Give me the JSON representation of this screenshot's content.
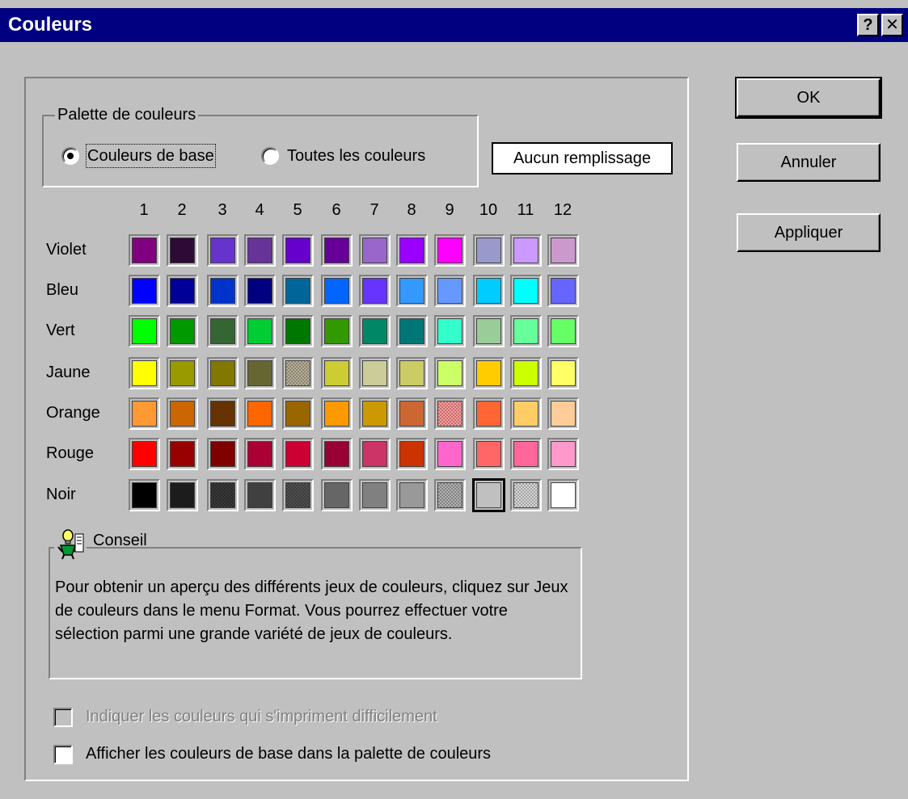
{
  "window": {
    "title": "Couleurs",
    "help_glyph": "?",
    "close_glyph": "✕"
  },
  "palette_group": {
    "legend": "Palette de couleurs",
    "options": [
      {
        "label": "Couleurs de base",
        "mnemonic": "l",
        "selected": true
      },
      {
        "label": "Toutes les couleurs",
        "mnemonic": "o",
        "selected": false
      }
    ]
  },
  "no_fill_label": "Aucun remplissage",
  "grid": {
    "columns": [
      "1",
      "2",
      "3",
      "4",
      "5",
      "6",
      "7",
      "8",
      "9",
      "10",
      "11",
      "12"
    ],
    "selected": {
      "row": 6,
      "col": 9
    },
    "rows": [
      {
        "label": "Violet",
        "colors": [
          "#800080",
          "#2e0a36",
          "#6633cc",
          "#663399",
          "#6600cc",
          "#660099",
          "#9966cc",
          "#9900ff",
          "#ff00ff",
          "#9999cc",
          "#cc99ff",
          "#cc99cc"
        ]
      },
      {
        "label": "Bleu",
        "colors": [
          "#0000ff",
          "#000099",
          "#0033cc",
          "#000080",
          "#006699",
          "#0066ff",
          "#6633ff",
          "#3399ff",
          "#6699ff",
          "#00ccff",
          "#00ffff",
          "#6666ff"
        ]
      },
      {
        "label": "Vert",
        "colors": [
          "#00ff00",
          "#009900",
          "#336633",
          "#00cc33",
          "#007700",
          "#339900",
          "#008866",
          "#007777",
          "#33ffcc",
          "#99cc99",
          "#66ff99",
          "#66ff66"
        ]
      },
      {
        "label": "Jaune",
        "colors": [
          "#ffff00",
          "#999900",
          "#807800",
          "#666633",
          "#b8b098",
          "#cccc33",
          "#cccc99",
          "#cccc66",
          "#ccff66",
          "#ffcc00",
          "#ccff00",
          "#ffff66"
        ]
      },
      {
        "label": "Orange",
        "colors": [
          "#ff9933",
          "#cc6600",
          "#663300",
          "#ff6600",
          "#996600",
          "#ff9900",
          "#cc9900",
          "#cc6633",
          "#ff9999",
          "#ff6633",
          "#ffcc66",
          "#ffcc99"
        ]
      },
      {
        "label": "Rouge",
        "colors": [
          "#ff0000",
          "#990000",
          "#800000",
          "#aa0033",
          "#cc0033",
          "#990033",
          "#cc3366",
          "#cc3300",
          "#ff66cc",
          "#ff6666",
          "#ff6699",
          "#ff99cc"
        ]
      },
      {
        "label": "Noir",
        "colors": [
          "#000000",
          "#202020",
          "#383838",
          "#404040",
          "#505050",
          "#666666",
          "#808080",
          "#999999",
          "#b0b0b0",
          "#c0c0c0",
          "#d8d8d8",
          "#ffffff"
        ]
      }
    ],
    "dithered": [
      "3-4",
      "4-8",
      "6-1",
      "6-2",
      "6-4",
      "6-8",
      "6-10"
    ]
  },
  "tip": {
    "legend": "Conseil",
    "icon": "lightbulb-assistant-icon",
    "text": "Pour obtenir un aperçu des différents jeux de couleurs, cliquez sur Jeux de couleurs dans le menu Format. Vous pourrez effectuer votre sélection parmi une grande variété de jeux de couleurs."
  },
  "checkboxes": [
    {
      "label": "Indiquer les couleurs qui s'impriment difficilement",
      "enabled": false,
      "checked": false
    },
    {
      "label": "Afficher les couleurs de base dans la palette de couleurs",
      "enabled": true,
      "checked": false
    }
  ],
  "buttons": {
    "ok": "OK",
    "cancel": "Annuler",
    "apply": "Appliquer"
  }
}
